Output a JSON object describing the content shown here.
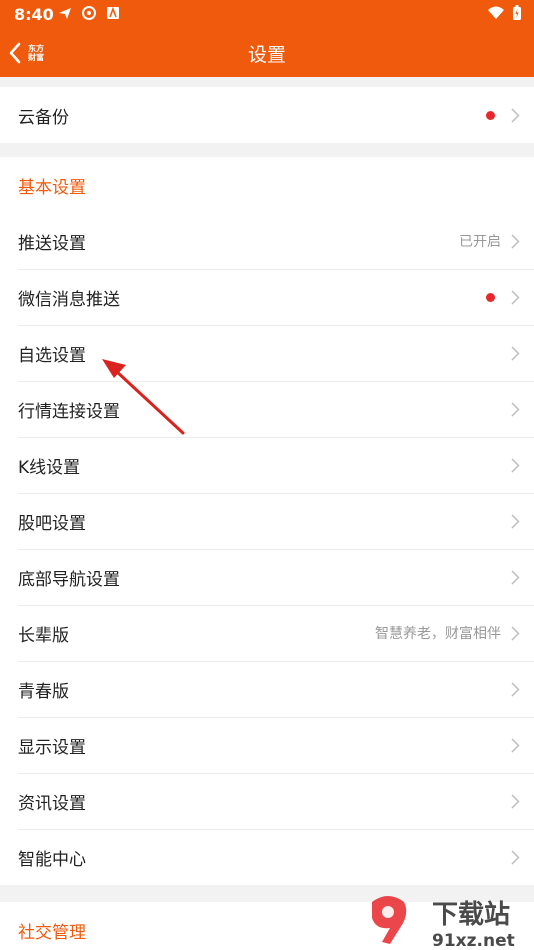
{
  "status_bar": {
    "time": "8:40"
  },
  "header": {
    "title": "设置",
    "logo_line1": "东方",
    "logo_line2": "财富"
  },
  "top_item": {
    "label": "云备份",
    "has_red_dot": true
  },
  "basic_section": {
    "title": "基本设置",
    "items": [
      {
        "label": "推送设置",
        "status": "已开启"
      },
      {
        "label": "微信消息推送",
        "status": ""
      },
      {
        "label": "自选设置",
        "status": ""
      },
      {
        "label": "行情连接设置",
        "status": ""
      },
      {
        "label": "K线设置",
        "status": ""
      },
      {
        "label": "股吧设置",
        "status": ""
      },
      {
        "label": "底部导航设置",
        "status": ""
      },
      {
        "label": "长辈版",
        "status": "智慧养老，财富相伴"
      },
      {
        "label": "青春版",
        "status": ""
      },
      {
        "label": "显示设置",
        "status": ""
      },
      {
        "label": "资讯设置",
        "status": ""
      },
      {
        "label": "智能中心",
        "status": ""
      }
    ]
  },
  "social_section": {
    "title": "社交管理"
  },
  "watermark": {
    "brand_text": "下载站",
    "domain": "91xz.net"
  },
  "colors": {
    "accent": "#f05a0c",
    "red_dot": "#e8272b",
    "annotation": "#d9231f"
  }
}
